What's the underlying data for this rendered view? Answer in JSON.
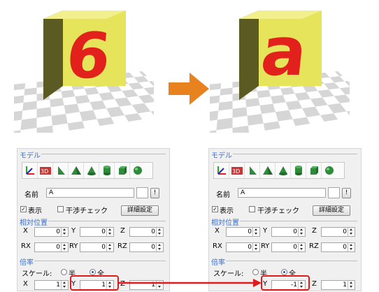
{
  "colors": {
    "accent_red": "#e01b1b",
    "arrow_orange": "#e8821e",
    "group_title_blue": "#3b6fd0",
    "cube_yellow": "#e6e45a",
    "letter_red": "#e2211c"
  },
  "before": {
    "letter": "6"
  },
  "after": {
    "letter": "a"
  },
  "panels": [
    {
      "model_title": "モデル",
      "name_label": "名前",
      "name_value": "A",
      "more_button": "!",
      "show_label": "表示",
      "show_checked": "✓",
      "interference_label": "干渉チェック",
      "details_button": "詳細設定",
      "relpos_title": "相対位置",
      "x_label": "X",
      "y_label": "Y",
      "z_label": "Z",
      "rx_label": "RX",
      "ry_label": "RY",
      "rz_label": "RZ",
      "pos_x": "0",
      "pos_y": "0",
      "pos_z": "0",
      "rot_x": "0",
      "rot_y": "0",
      "rot_z": "0",
      "scale_title": "倍率",
      "scale_label": "スケール:",
      "half_label": "半",
      "full_label": "全",
      "scale_x": "1",
      "scale_y": "1",
      "scale_z": "1"
    },
    {
      "model_title": "モデル",
      "name_label": "名前",
      "name_value": "A",
      "more_button": "!",
      "show_label": "表示",
      "show_checked": "✓",
      "interference_label": "干渉チェック",
      "details_button": "詳細設定",
      "relpos_title": "相対位置",
      "x_label": "X",
      "y_label": "Y",
      "z_label": "Z",
      "rx_label": "RX",
      "ry_label": "RY",
      "rz_label": "RZ",
      "pos_x": "0",
      "pos_y": "0",
      "pos_z": "0",
      "rot_x": "0",
      "rot_y": "0",
      "rot_z": "0",
      "scale_title": "倍率",
      "scale_label": "スケール:",
      "half_label": "半",
      "full_label": "全",
      "scale_x": "",
      "scale_y": "-1",
      "scale_z": "1"
    }
  ],
  "toolbar_icons": [
    "axes-icon",
    "3d-model-icon",
    "wedge-icon",
    "pyramid-icon",
    "cone-icon",
    "cylinder-icon",
    "box-icon",
    "sphere-icon"
  ]
}
